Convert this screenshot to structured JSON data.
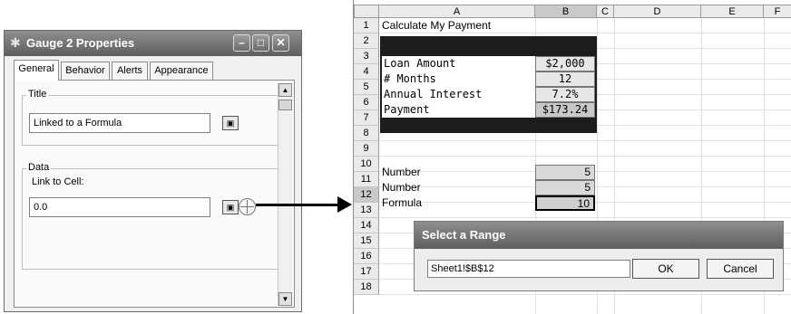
{
  "dialog": {
    "title": "Gauge 2 Properties",
    "tabs": [
      {
        "label": "General"
      },
      {
        "label": "Behavior"
      },
      {
        "label": "Alerts"
      },
      {
        "label": "Appearance"
      }
    ],
    "title_group": {
      "legend": "Title",
      "value": "Linked to a Formula"
    },
    "data_group": {
      "legend": "Data",
      "link_label": "Link to Cell:",
      "value": "0.0"
    },
    "icons": {
      "app": "gear-icon",
      "pick": "range-picker-icon",
      "target": "crosshair-icon"
    }
  },
  "sheet": {
    "columns": [
      "A",
      "B",
      "C",
      "D",
      "E",
      "F"
    ],
    "rows": [
      "1",
      "2",
      "3",
      "4",
      "5",
      "6",
      "7",
      "8",
      "9",
      "10",
      "11",
      "12",
      "13",
      "14",
      "15",
      "16",
      "17",
      "18"
    ],
    "title_cell": "Calculate My Payment",
    "loan": [
      {
        "label": "Loan Amount",
        "value": "$2,000"
      },
      {
        "label": "# Months",
        "value": "12"
      },
      {
        "label": "Annual Interest",
        "value": "7.2%"
      },
      {
        "label": "Payment",
        "value": "$173.24"
      }
    ],
    "numbers": [
      {
        "label": "Number",
        "value": "5"
      },
      {
        "label": "Number",
        "value": "5"
      },
      {
        "label": "Formula",
        "value": "10"
      }
    ]
  },
  "range_dialog": {
    "title": "Select a Range",
    "value": "Sheet1!$B$12",
    "ok": "OK",
    "cancel": "Cancel"
  }
}
